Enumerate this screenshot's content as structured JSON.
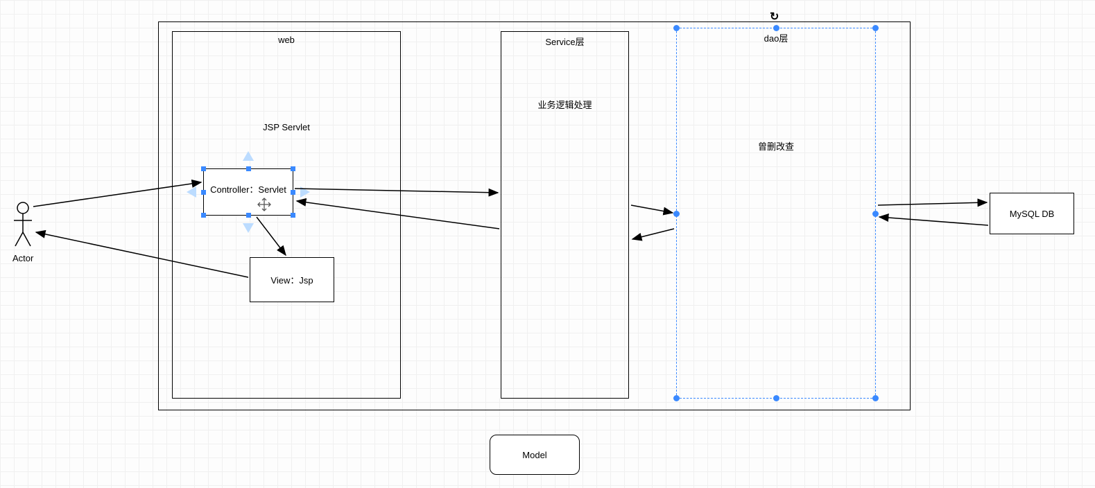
{
  "actor": {
    "label": "Actor"
  },
  "outer_container": {},
  "web_box": {
    "title": "web",
    "subtitle": "JSP Servlet",
    "controller": {
      "label": "Controller：Servlet"
    },
    "view": {
      "label": "View：Jsp"
    }
  },
  "service_box": {
    "title": "Service层",
    "subtitle": "业务逻辑处理"
  },
  "dao_box": {
    "title": "dao层",
    "subtitle": "曾删改查"
  },
  "mysql_box": {
    "label": "MySQL DB"
  },
  "model_box": {
    "label": "Model"
  },
  "rotate_icon": "↻"
}
